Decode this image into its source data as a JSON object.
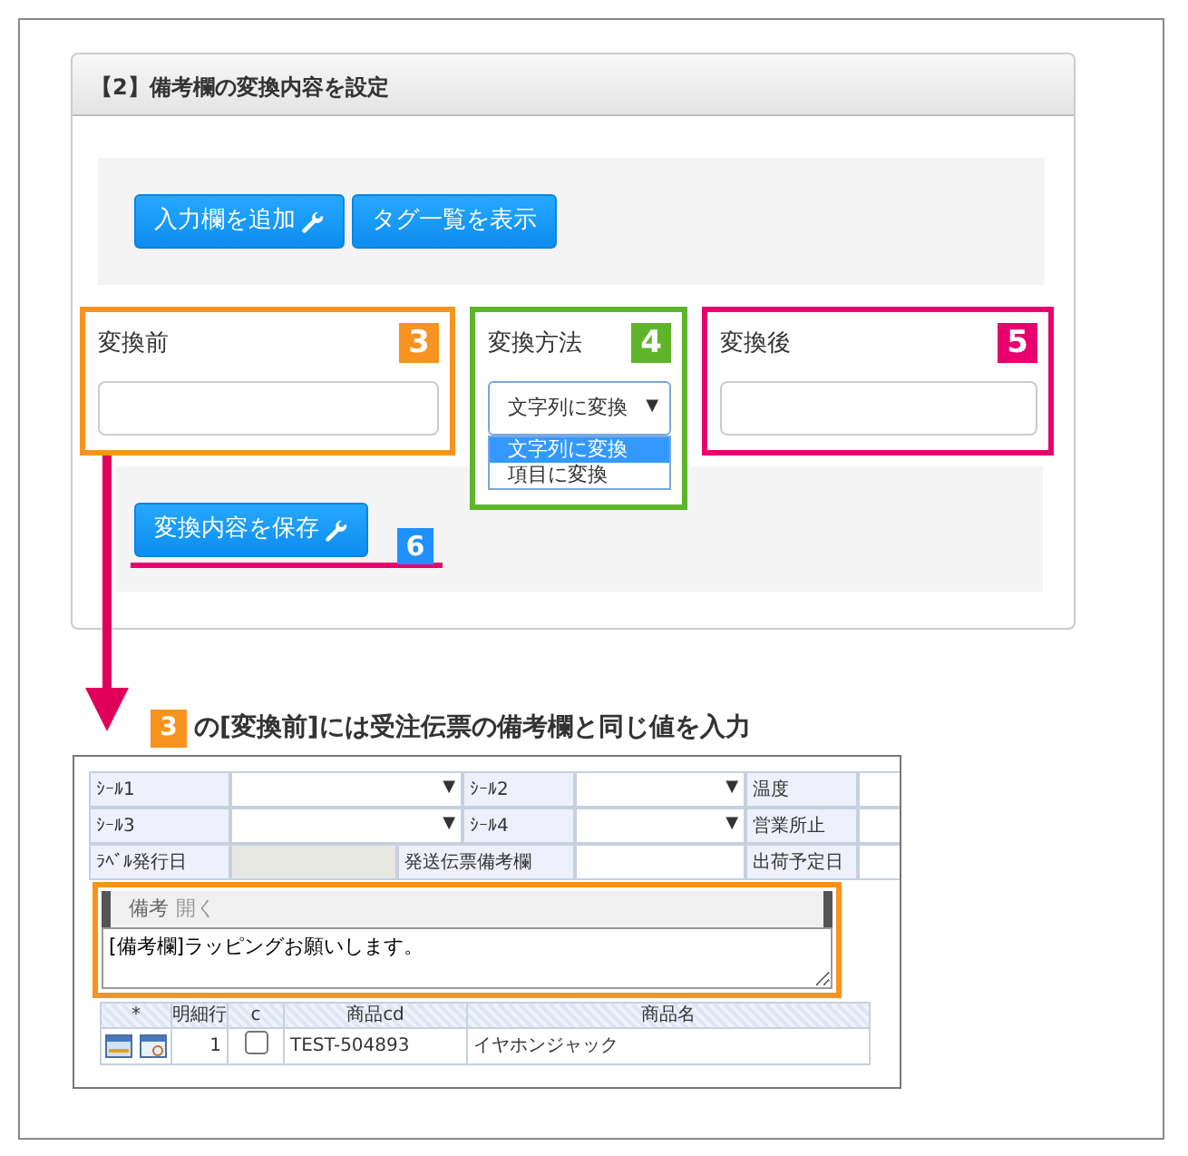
{
  "panel": {
    "title": "【2】備考欄の変換内容を設定",
    "buttons": [
      {
        "label": "入力欄を追加",
        "icon": true
      },
      {
        "label": "タグ一覧を表示",
        "icon": false
      }
    ]
  },
  "fields": [
    {
      "kind": "text",
      "label": "変換前",
      "badge": "3",
      "color": "#f7931e"
    },
    {
      "kind": "select",
      "label": "変換方法",
      "badge": "4",
      "color": "#5fb52a",
      "value": "文字列に変換",
      "caret": "▼",
      "options": [
        {
          "label": "文字列に変換",
          "selected": true
        },
        {
          "label": "項目に変換",
          "selected": false
        }
      ]
    },
    {
      "kind": "text",
      "label": "変換後",
      "badge": "5",
      "color": "#e8006e"
    }
  ],
  "save": {
    "label": "変換内容を保存",
    "icon": true,
    "badge": "6"
  },
  "caption": {
    "badge": "3",
    "text": "の[変換前]には受注伝票の備考欄と同じ値を入力"
  },
  "order_form": {
    "rows": [
      [
        {
          "kind": "label",
          "text": "ｼｰﾙ1"
        },
        {
          "kind": "select",
          "text": "▼"
        },
        {
          "kind": "label",
          "text": "ｼｰﾙ2"
        },
        {
          "kind": "select",
          "text": "▼"
        },
        {
          "kind": "label",
          "text": "温度"
        },
        {
          "kind": "input"
        }
      ],
      [
        {
          "kind": "label",
          "text": "ｼｰﾙ3"
        },
        {
          "kind": "select",
          "text": "▼"
        },
        {
          "kind": "label",
          "text": "ｼｰﾙ4"
        },
        {
          "kind": "select",
          "text": "▼"
        },
        {
          "kind": "label",
          "text": "営業所止"
        },
        {
          "kind": "input"
        }
      ],
      [
        {
          "kind": "label",
          "text": "ﾗﾍﾞﾙ発行日"
        },
        {
          "kind": "readonly"
        },
        {
          "kind": "label",
          "text": "発送伝票備考欄"
        },
        {
          "kind": "input"
        },
        {
          "kind": "label",
          "text": "出荷予定日"
        },
        {
          "kind": "input"
        }
      ]
    ],
    "remarks": {
      "title": "備考",
      "toggle": "開く",
      "value": "[備考欄]ラッピングお願いします。"
    },
    "grid": {
      "columns": [
        "*",
        "明細行",
        "c",
        "商品cd",
        "商品名"
      ],
      "rows": [
        {
          "line": "1",
          "checked": false,
          "code": "TEST-504893",
          "name": "イヤホンジャック"
        }
      ]
    }
  }
}
